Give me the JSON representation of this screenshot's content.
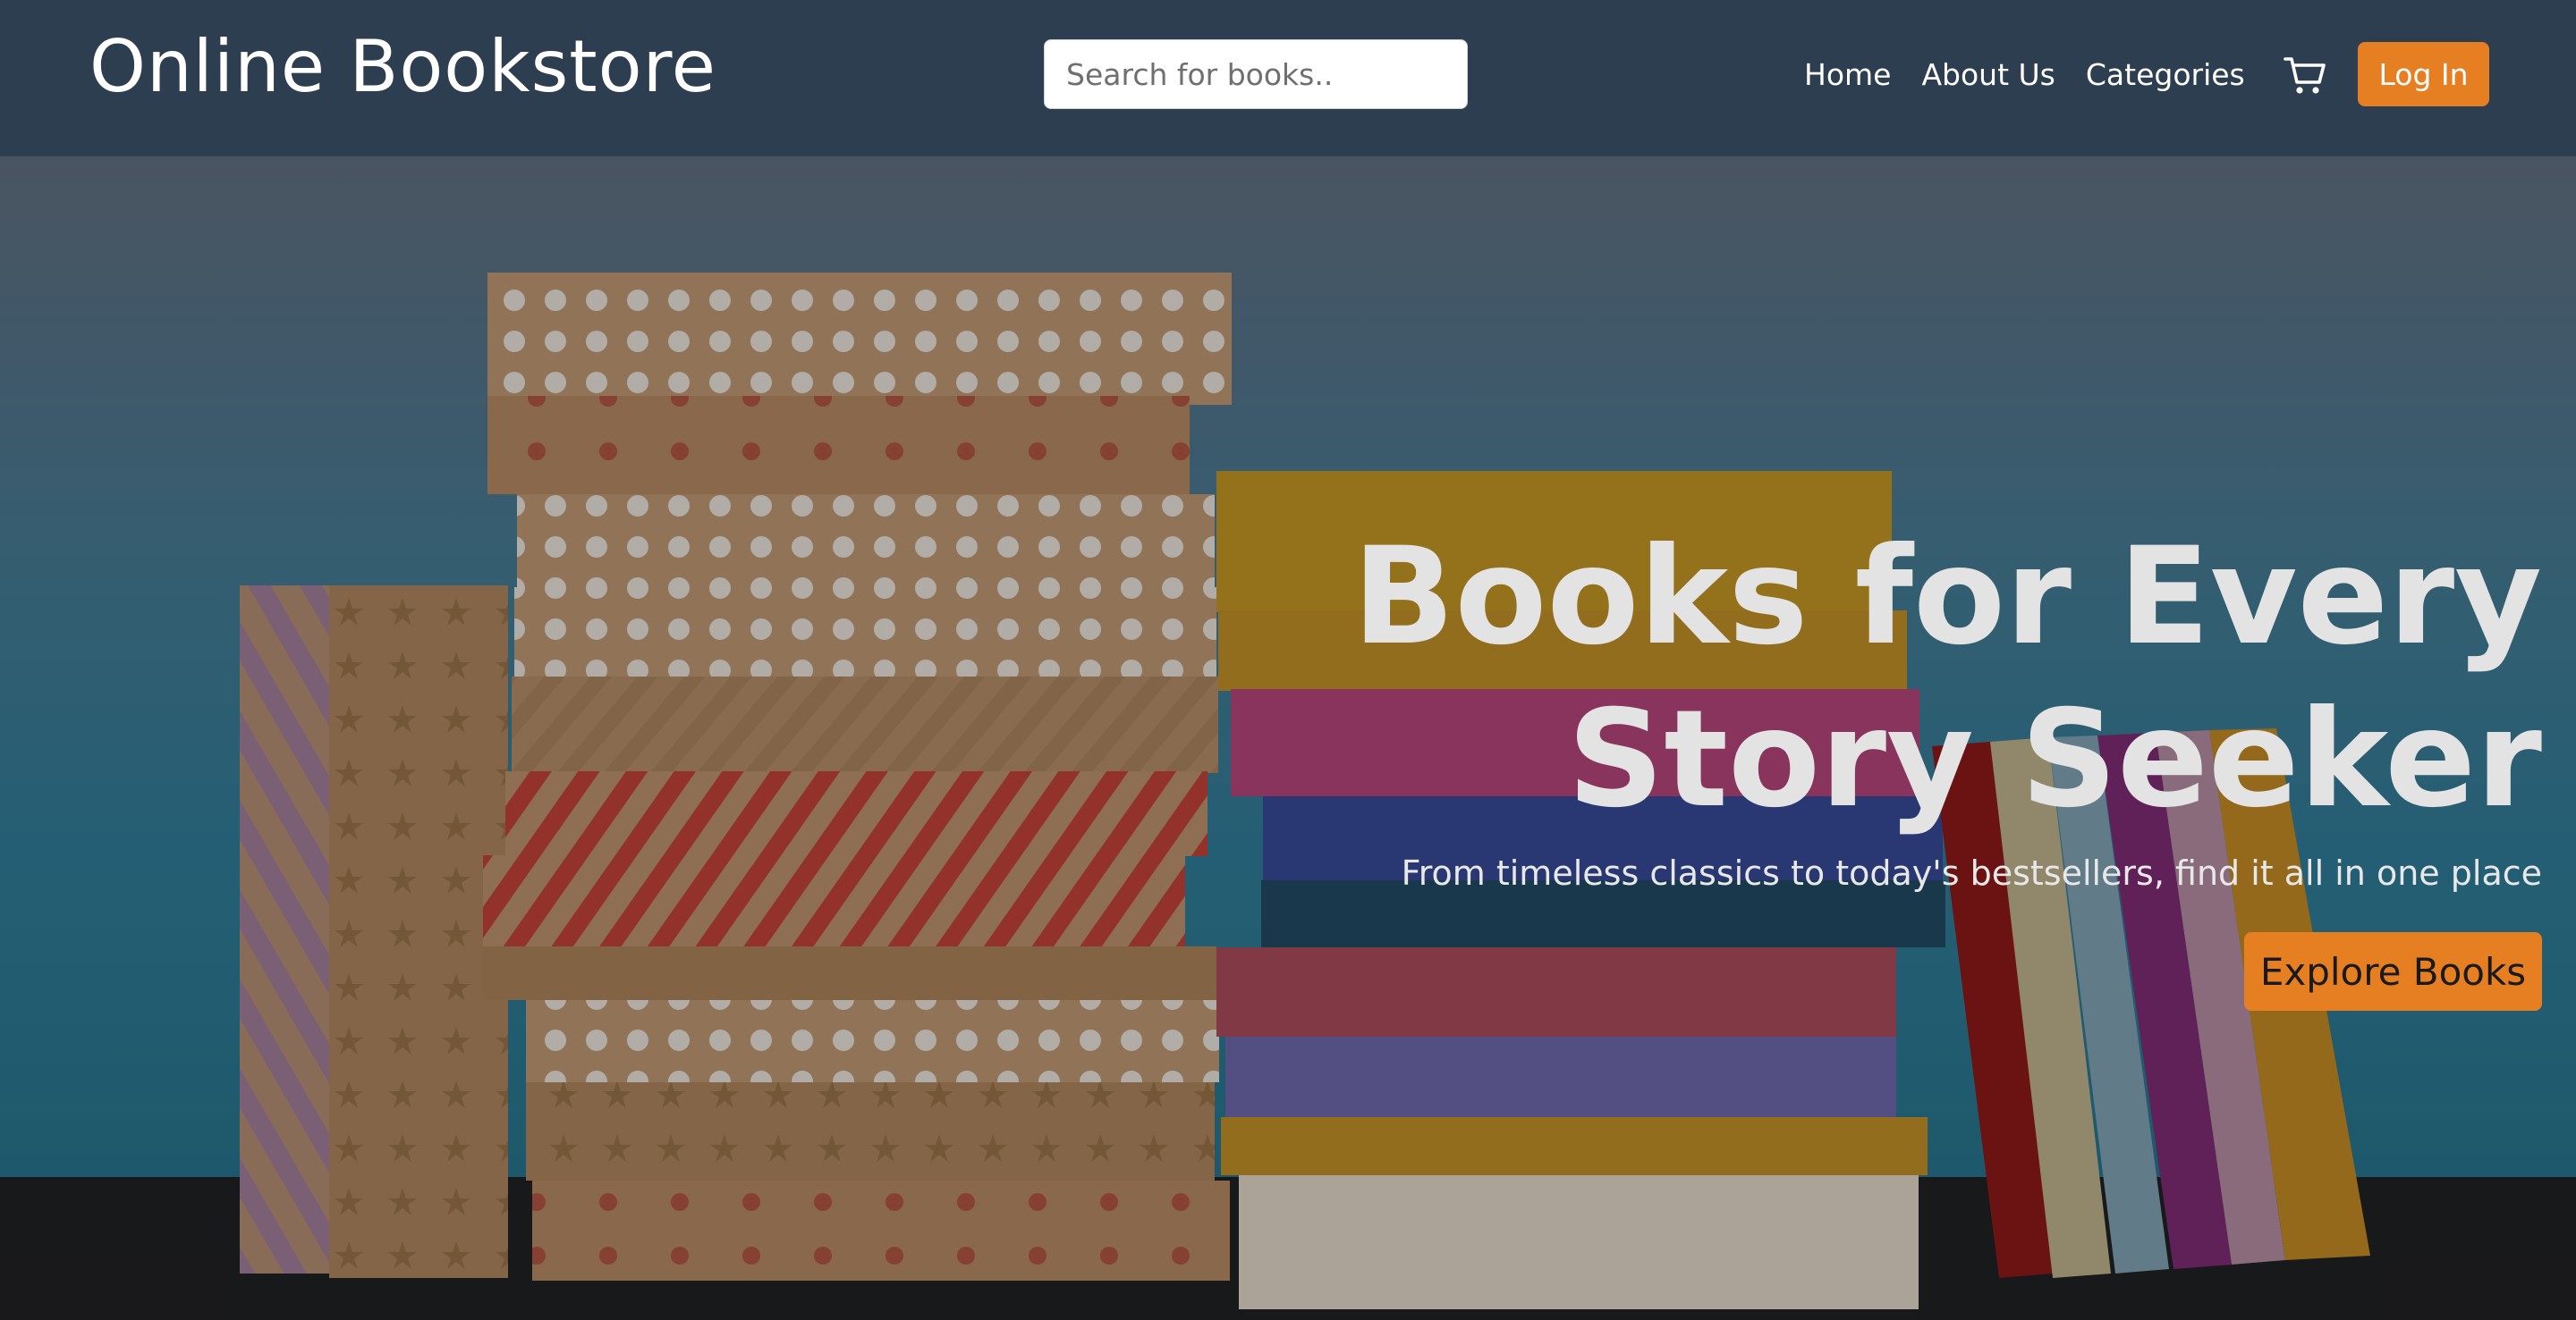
{
  "header": {
    "brand": "Online Bookstore",
    "search_placeholder": "Search for books..",
    "nav": [
      "Home",
      "About Us",
      "Categories"
    ],
    "cart_icon": "shopping-cart-icon",
    "login_label": "Log In"
  },
  "hero": {
    "title_line1": "Books for Every",
    "title_line2": "Story Seeker",
    "subtitle": "From timeless classics to today's bestsellers, find it all in one place",
    "cta_label": "Explore Books"
  },
  "colors": {
    "navbar_bg": "#2c3e50",
    "accent": "#e67e22",
    "hero_bg_top": "#55606f",
    "hero_bg_bottom": "#1f6277"
  }
}
